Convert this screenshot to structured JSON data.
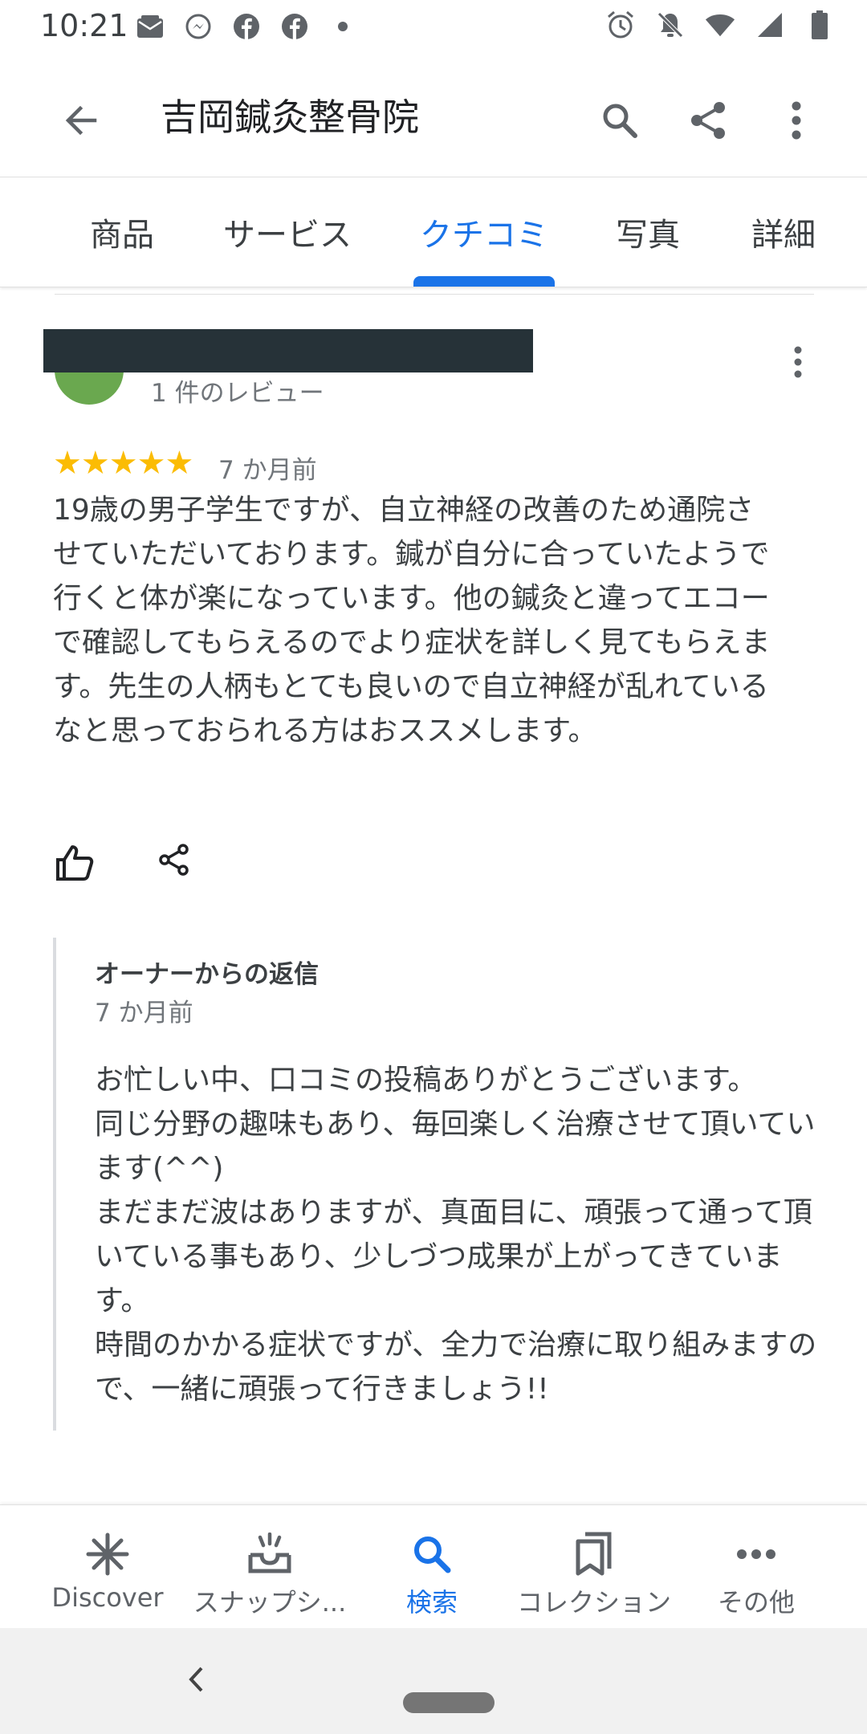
{
  "status_bar": {
    "time": "10:21",
    "left_icons": [
      "mail-icon",
      "facebook-messenger-icon",
      "facebook-icon",
      "facebook-icon",
      "dot-icon"
    ],
    "right_icons": [
      "alarm-icon",
      "notifications-off-icon",
      "wifi-icon",
      "signal-icon",
      "battery-icon"
    ]
  },
  "app_bar": {
    "title": "吉岡鍼灸整骨院",
    "icons": [
      "back-arrow-icon",
      "search-icon",
      "share-icon",
      "more-vert-icon"
    ]
  },
  "tabs": [
    {
      "label": "商品",
      "active": false
    },
    {
      "label": "サービス",
      "active": false
    },
    {
      "label": "クチコミ",
      "active": true
    },
    {
      "label": "写真",
      "active": false
    },
    {
      "label": "詳細",
      "active": false
    }
  ],
  "review": {
    "review_count": "1 件のレビュー",
    "rating": 5,
    "stars": "★★★★★",
    "time": "7 か月前",
    "text": "19歳の男子学生ですが、自立神経の改善のため通院させていただいております。鍼が自分に合っていたようで行くと体が楽になっています。他の鍼灸と違ってエコーで確認してもらえるのでより症状を詳しく見てもらえます。先生の人柄もとても良いので自立神経が乱れているなと思っておられる方はおススメします。"
  },
  "owner_reply": {
    "label": "オーナーからの返信",
    "time": "7 か月前",
    "text": "お忙しい中、口コミの投稿ありがとうございます。\n同じ分野の趣味もあり、毎回楽しく治療させて頂いています(^^)\nまだまだ波はありますが、真面目に、頑張って通って頂いている事もあり、少しづつ成果が上がってきています。\n時間のかかる症状ですが、全力で治療に取り組みますので、一緒に頑張って行きましょう!!"
  },
  "bottom_nav": [
    {
      "label": "Discover",
      "icon": "asterisk-icon",
      "active": false
    },
    {
      "label": "スナップシ...",
      "icon": "snapshot-icon",
      "active": false
    },
    {
      "label": "検索",
      "icon": "search-icon",
      "active": true
    },
    {
      "label": "コレクション",
      "icon": "bookmarks-icon",
      "active": false
    },
    {
      "label": "その他",
      "icon": "more-horiz-icon",
      "active": false
    }
  ],
  "colors": {
    "accent": "#1a73e8",
    "star": "#fbbc04",
    "avatar": "#6aa84f",
    "redaction": "#263238"
  }
}
